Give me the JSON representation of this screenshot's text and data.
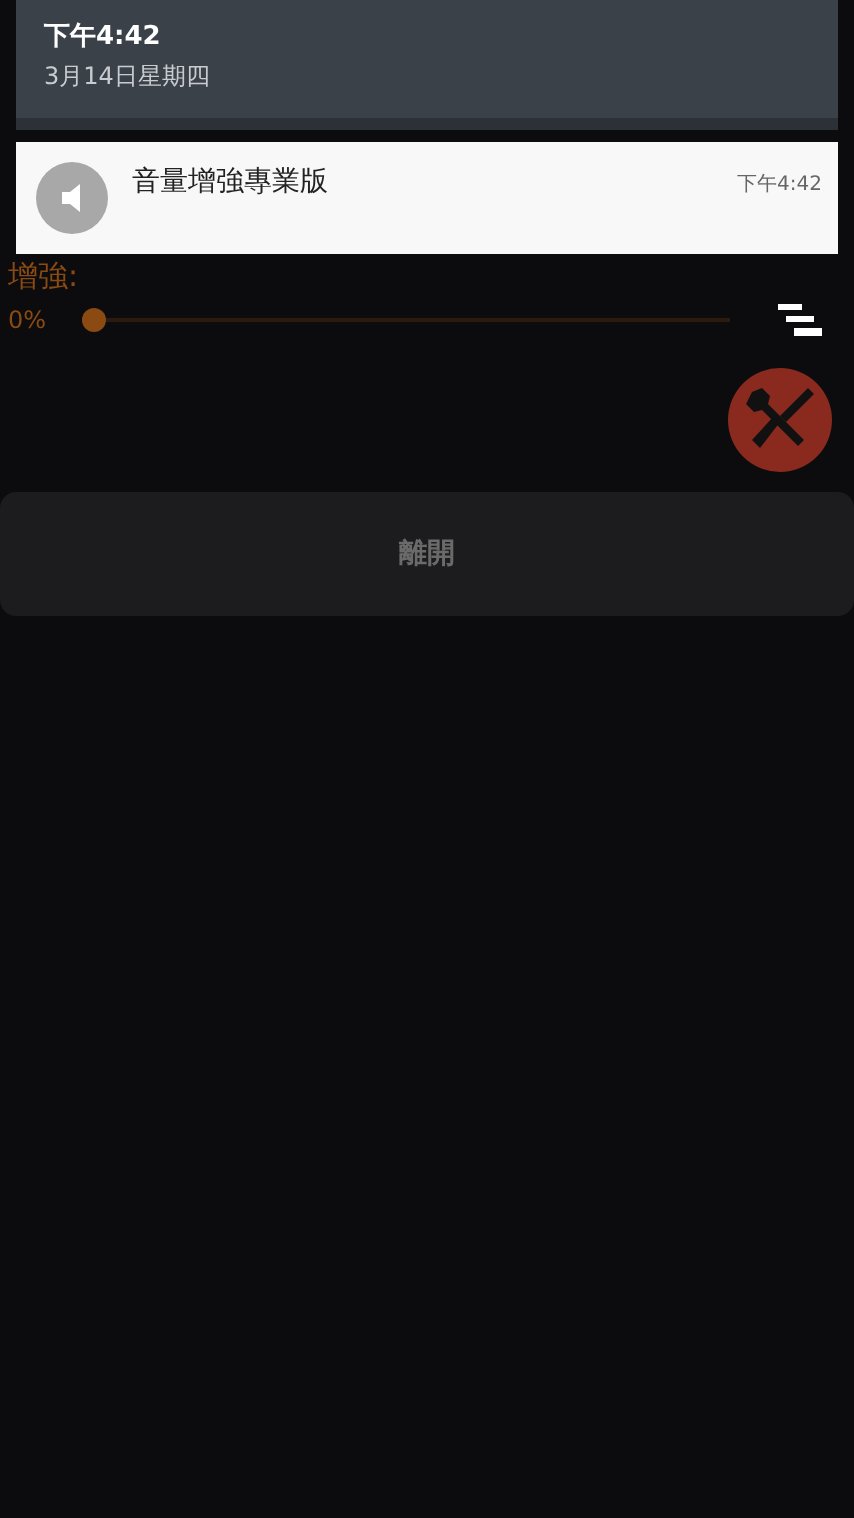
{
  "shade": {
    "time": "下午4:42",
    "date": "3月14日星期四"
  },
  "notification": {
    "title": "音量增強專業版",
    "time": "下午4:42"
  },
  "app": {
    "boost_label": "增強:",
    "boost_reading": "0%",
    "boost": {
      "level": 0
    },
    "exit_button": "離開"
  }
}
